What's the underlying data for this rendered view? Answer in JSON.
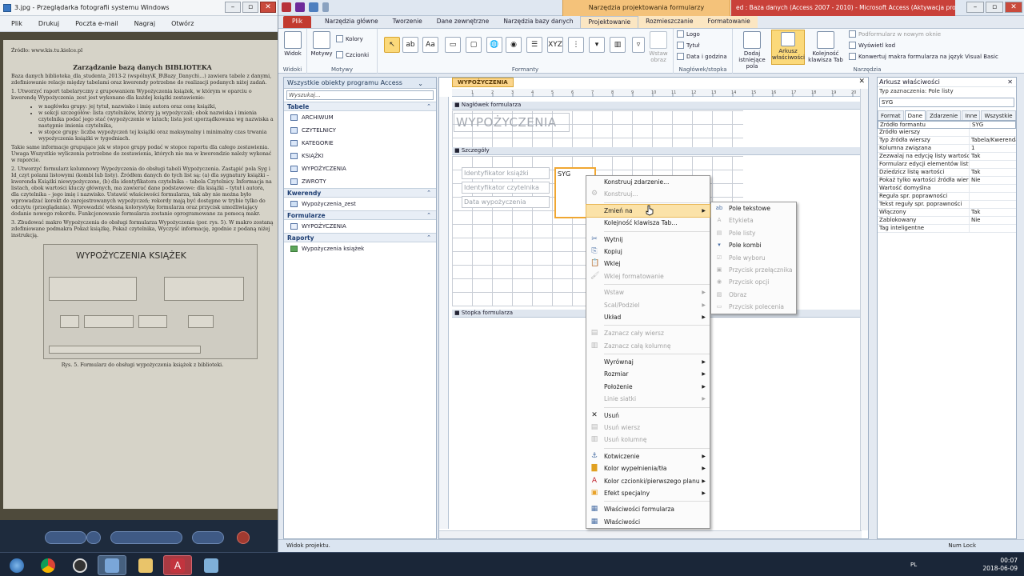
{
  "viewer": {
    "title": "3.jpg - Przeglądarka fotografii systemu Windows",
    "menu": [
      "Plik",
      "Drukuj",
      "Poczta e-mail",
      "Nagraj",
      "Otwórz"
    ],
    "doc_source": "Źródło: www.kis.tu.kielce.pl",
    "doc_heading": "Zarządzanie bazą danych BIBLIOTEKA",
    "doc_p1": "Baza danych biblioteka_dla_studenta_2013-2 (wspólny\\K_B\\Bazy_Danych\\...) zawiera tabele z danymi, zdefiniowanie relacje między tabelami oraz kwerendy potrzebne do realizacji podanych niżej zadań.",
    "doc_p2": "1. Utworzyć raport tabelaryczny z grupowaniem Wypożyczenia książek, w którym w oparciu o kwerendę Wypożyczenia_zest jest wykonane dla każdej książki zestawienie:",
    "doc_b1": "w nagłówku grupy: jej tytuł, nazwisko i imię autora oraz cenę książki,",
    "doc_b2": "w sekcji szczegółów: lista czytelników, którzy ją wypożyczali; obok nazwiska i imienia czytelnika podać jego stać (wypożyczenie w latach; lista jest uporządkowana wg nazwiska a następnie imienia czytelnika,",
    "doc_b3": "w stopce grupy: liczba wypożyczeń tej książki oraz maksymalny i minimalny czas trwania wypożyczenia książki w tygodniach.",
    "doc_p3": "Takie same informacje grupujące jak w stopce grupy podać w stopce raportu dla całego zestawienia. Uwaga Wszystkie wyliczenia potrzebne do zestawienia, których nie ma w kwerendzie należy wykonać w raporcie.",
    "doc_p4": "2. Utworzyć formularz kolumnowy Wypożyczenia do obsługi tabeli Wypożyczenia. Zastąpić pola Syg i Id_czyt polami listowymi (kombi lub listy). Źródłem danych do tych list są: (a) dla sygnatury książki – kwerenda Książki niewypożyczone, (b) dla identyfikatora czytelnika – tabela Czytelnicy. Informacja na listach, obok wartości kluczy głównych, ma zawierać dane podstawowe: dla książki – tytuł i autora, dla czytelnika – jego imię i nazwisko. Ustawić właściwości formularza, tak aby nie można było wprowadzać korekt do zarejestrowanych wypożyczeń; rekordy mają być dostępne w trybie tylko do odczytu (przeglądania). Wprowadzić własną kolorystykę formularza oraz przycisk umożliwiający dodanie nowego rekordu. Funkcjonowanie formularza zostanie oprogramowane za pomocą makr.",
    "doc_p5": "3. Zbudować makro Wypożyczenia do obsługi formularza Wypożyczenia (por. rys. 5). W makro zostaną zdefiniowane podmakra Pokaż książkę, Pokaż czytelnika, Wyczyść informację, zgodnie z podaną niżej instrukcją.",
    "fig_title": "WYPOŻYCZENIA KSIĄŻEK",
    "fig_caption": "Rys. 5. Formularz do obsługi wypożyczenia książek z biblioteki."
  },
  "access": {
    "app_title": "ed : Baza danych (Access 2007 - 2010) - Microsoft Access (Aktywacja produkt...",
    "context_tab_title": "Narzędzia projektowania formularzy",
    "tabs": [
      "Plik",
      "Narzędzia główne",
      "Tworzenie",
      "Dane zewnętrzne",
      "Narzędzia bazy danych",
      "Projektowanie",
      "Rozmieszczanie",
      "Formatowanie"
    ],
    "ribbon": {
      "widok": "Widok",
      "widoki": "Widoki",
      "motywy": "Motywy",
      "kolory": "Kolory",
      "czcionki": "Czcionki",
      "motywy_group": "Motywy",
      "formanty_group": "Formanty",
      "wstaw_obraz": "Wstaw obraz",
      "logo": "Logo",
      "tytul": "Tytuł",
      "data_godzina": "Data i godzina",
      "naglowek_group": "Nagłówek/stopka",
      "dodaj_pola": "Dodaj istniejące pola",
      "arkusz": "Arkusz właściwości",
      "kolejnosc": "Kolejność klawisza Tab",
      "podformularz": "Podformularz w nowym oknie",
      "wyswietl_kod": "Wyświetl kod",
      "konwertuj": "Konwertuj makra formularza na język Visual Basic",
      "narzedzia_group": "Narzędzia"
    },
    "nav": {
      "header": "Wszystkie obiekty programu Access",
      "search_placeholder": "Wyszukaj...",
      "sections": [
        {
          "name": "Tabele",
          "items": [
            "ARCHIWUM",
            "CZYTELNICY",
            "KATEGORIE",
            "KSIĄŻKI",
            "WYPOŻYCZENIA",
            "ZWROTY"
          ]
        },
        {
          "name": "Kwerendy",
          "items": [
            "Wypożyczenia_zest"
          ]
        },
        {
          "name": "Formularze",
          "items": [
            "WYPOŻYCZENIA"
          ]
        },
        {
          "name": "Raporty",
          "items": [
            "Wypożyczenia książek"
          ]
        }
      ]
    },
    "doc": {
      "tab": "WYPOŻYCZENIA",
      "section_header": "Nagłówek formularza",
      "section_detail": "Szczegóły",
      "section_footer": "Stopka formularza",
      "form_title": "WYPOŻYCZENIA",
      "labels": [
        "Identyfikator książki",
        "Identyfikator czytelnika",
        "Data wypożyczenia"
      ],
      "combo_value": "SYG",
      "ruler": [
        "1",
        "2",
        "3",
        "4",
        "5",
        "6",
        "7",
        "8",
        "9",
        "10",
        "11",
        "12",
        "13",
        "14",
        "15",
        "16",
        "17",
        "18",
        "19",
        "20"
      ]
    },
    "props": {
      "title": "Arkusz właściwości",
      "selection_type": "Typ zaznaczenia:  Pole listy",
      "selected": "SYG",
      "tabs": [
        "Format",
        "Dane",
        "Zdarzenie",
        "Inne",
        "Wszystkie"
      ],
      "active_tab": "Dane",
      "rows": [
        {
          "k": "Źródło formantu",
          "v": "SYG"
        },
        {
          "k": "Źródło wierszy",
          "v": ""
        },
        {
          "k": "Typ źródła wierszy",
          "v": "Tabela/Kwerenda"
        },
        {
          "k": "Kolumna związana",
          "v": "1"
        },
        {
          "k": "Zezwalaj na edycję listy wartości",
          "v": "Tak"
        },
        {
          "k": "Formularz edycji elementów listy",
          "v": ""
        },
        {
          "k": "Dziedzicz listę wartości",
          "v": "Tak"
        },
        {
          "k": "Pokaż tylko wartości źródła wierszy",
          "v": "Nie"
        },
        {
          "k": "Wartość domyślna",
          "v": ""
        },
        {
          "k": "Reguła spr. poprawności",
          "v": ""
        },
        {
          "k": "Tekst reguły spr. poprawności",
          "v": ""
        },
        {
          "k": "Włączony",
          "v": "Tak"
        },
        {
          "k": "Zablokowany",
          "v": "Nie"
        },
        {
          "k": "Tag inteligentne",
          "v": ""
        }
      ]
    },
    "status": {
      "left": "Widok projektu.",
      "numlock": "Num Lock"
    }
  },
  "context_menu": {
    "items": [
      {
        "label": "Konstruuj zdarzenie...",
        "disabled": false
      },
      {
        "label": "Konstruuj...",
        "disabled": true
      },
      {
        "label": "Zmień na",
        "disabled": false,
        "submenu": true,
        "highlighted": true
      },
      {
        "label": "Kolejność klawisza Tab...",
        "disabled": false
      },
      {
        "label": "Wytnij",
        "disabled": false
      },
      {
        "label": "Kopiuj",
        "disabled": false
      },
      {
        "label": "Wklej",
        "disabled": false
      },
      {
        "label": "Wklej formatowanie",
        "disabled": true
      },
      {
        "label": "Wstaw",
        "disabled": true,
        "submenu": true
      },
      {
        "label": "Scal/Podziel",
        "disabled": true,
        "submenu": true
      },
      {
        "label": "Układ",
        "disabled": false,
        "submenu": true
      },
      {
        "label": "Zaznacz cały wiersz",
        "disabled": true
      },
      {
        "label": "Zaznacz całą kolumnę",
        "disabled": true
      },
      {
        "label": "Wyrównaj",
        "disabled": false,
        "submenu": true
      },
      {
        "label": "Rozmiar",
        "disabled": false,
        "submenu": true
      },
      {
        "label": "Położenie",
        "disabled": false,
        "submenu": true
      },
      {
        "label": "Linie siatki",
        "disabled": true,
        "submenu": true
      },
      {
        "label": "Usuń",
        "disabled": false
      },
      {
        "label": "Usuń wiersz",
        "disabled": true
      },
      {
        "label": "Usuń kolumnę",
        "disabled": true
      },
      {
        "label": "Kotwiczenie",
        "disabled": false,
        "submenu": true
      },
      {
        "label": "Kolor wypełnienia/tła",
        "disabled": false,
        "submenu": true
      },
      {
        "label": "Kolor czcionki/pierwszego planu",
        "disabled": false,
        "submenu": true
      },
      {
        "label": "Efekt specjalny",
        "disabled": false,
        "submenu": true
      },
      {
        "label": "Właściwości formularza",
        "disabled": false
      },
      {
        "label": "Właściwości",
        "disabled": false
      }
    ],
    "submenu": [
      {
        "label": "Pole tekstowe",
        "disabled": false
      },
      {
        "label": "Etykieta",
        "disabled": true
      },
      {
        "label": "Pole listy",
        "disabled": true
      },
      {
        "label": "Pole kombi",
        "disabled": false
      },
      {
        "label": "Pole wyboru",
        "disabled": true
      },
      {
        "label": "Przycisk przełącznika",
        "disabled": true
      },
      {
        "label": "Przycisk opcji",
        "disabled": true
      },
      {
        "label": "Obraz",
        "disabled": true
      },
      {
        "label": "Przycisk polecenia",
        "disabled": true
      }
    ]
  },
  "taskbar": {
    "lang": "PL",
    "time": "00:07",
    "date": "2018-06-09"
  },
  "colors": {
    "accent": "#f0a732",
    "file_tab": "#c23a2f",
    "title_red": "#c9413a",
    "menu_highlight": "#fbe2a8"
  }
}
